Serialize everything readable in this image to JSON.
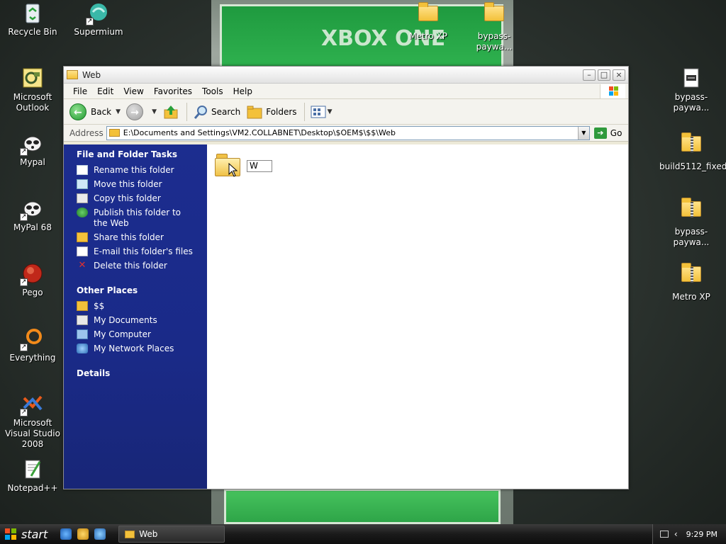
{
  "wallpaper": {
    "banner_text": "XBOX ONE"
  },
  "desktop_icons_left": [
    {
      "label": "Recycle Bin",
      "icon": "recycle-bin-icon"
    },
    {
      "label": "Microsoft Outlook",
      "icon": "outlook-icon"
    },
    {
      "label": "Mypal",
      "icon": "mypal-icon"
    },
    {
      "label": "MyPal 68",
      "icon": "mypal68-icon"
    },
    {
      "label": "Pego",
      "icon": "pego-icon"
    },
    {
      "label": "Everything",
      "icon": "everything-icon"
    },
    {
      "label": "Microsoft Visual Studio 2008",
      "icon": "visual-studio-icon"
    },
    {
      "label": "Notepad++",
      "icon": "notepadpp-icon"
    }
  ],
  "desktop_icons_top": [
    {
      "label": "Supermium",
      "icon": "supermium-icon"
    },
    {
      "label": "Metro XP",
      "icon": "folder-icon"
    },
    {
      "label": "bypass-paywa...",
      "icon": "folder-icon"
    }
  ],
  "desktop_icons_right": [
    {
      "label": "bypass-paywa...",
      "icon": "text-file-icon"
    },
    {
      "label": "build5112_fixed",
      "icon": "zip-folder-icon"
    },
    {
      "label": "bypass-paywa...",
      "icon": "zip-folder-icon"
    },
    {
      "label": "Metro XP",
      "icon": "zip-folder-icon"
    }
  ],
  "window": {
    "title": "Web",
    "menu": [
      "File",
      "Edit",
      "View",
      "Favorites",
      "Tools",
      "Help"
    ],
    "toolbar": {
      "back": "Back",
      "search": "Search",
      "folders": "Folders"
    },
    "address": {
      "label": "Address",
      "path": "E:\\Documents and Settings\\VM2.COLLABNET\\Desktop\\$OEM$\\$$\\Web",
      "go": "Go"
    },
    "tasks": {
      "header": "File and Folder Tasks",
      "items": [
        {
          "label": "Rename this folder",
          "icon": "rename-icon"
        },
        {
          "label": "Move this folder",
          "icon": "move-icon"
        },
        {
          "label": "Copy this folder",
          "icon": "copy-icon"
        },
        {
          "label": "Publish this folder to the Web",
          "icon": "publish-icon"
        },
        {
          "label": "Share this folder",
          "icon": "share-icon"
        },
        {
          "label": "E-mail this folder's files",
          "icon": "email-icon"
        },
        {
          "label": "Delete this folder",
          "icon": "delete-icon"
        }
      ]
    },
    "other_places": {
      "header": "Other Places",
      "items": [
        {
          "label": "$$",
          "icon": "folder-icon"
        },
        {
          "label": "My Documents",
          "icon": "my-documents-icon"
        },
        {
          "label": "My Computer",
          "icon": "my-computer-icon"
        },
        {
          "label": "My Network Places",
          "icon": "network-places-icon"
        }
      ]
    },
    "details": {
      "header": "Details"
    },
    "file_area": {
      "rename_value": "W"
    }
  },
  "taskbar": {
    "start": "start",
    "active_task": "Web",
    "clock": "9:29 PM"
  }
}
